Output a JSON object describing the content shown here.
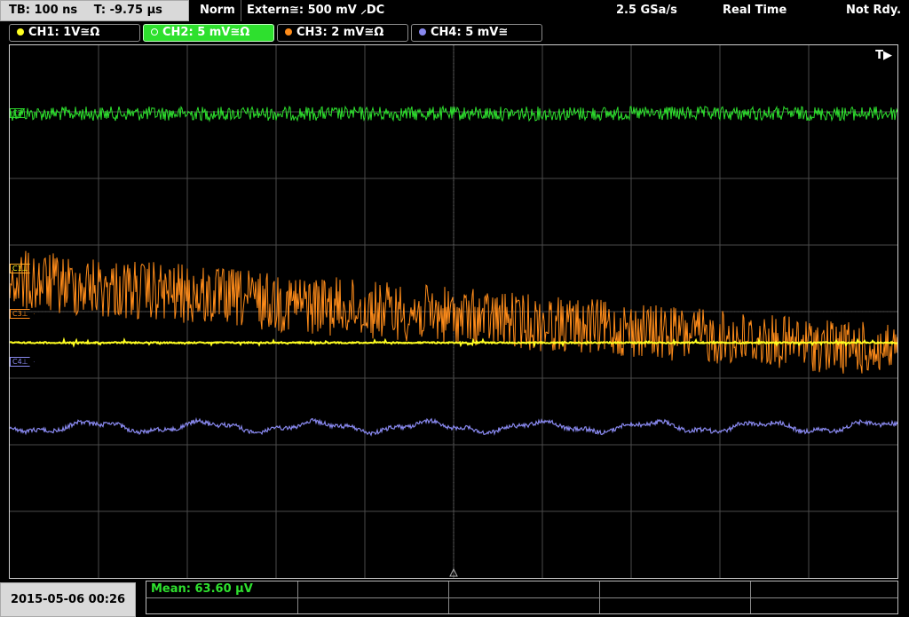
{
  "topbar": {
    "timebase": "TB: 100 ns",
    "trigger_time": "T: -9.75 µs",
    "mode": "Norm",
    "trigger_source": "Extern≅: 500 mV ⸝DC",
    "sample_rate": "2.5 GSa/s",
    "acq_mode": "Real Time",
    "status": "Not Rdy."
  },
  "channels": [
    {
      "label": "CH1: 1V≅Ω",
      "color": "#ffff22"
    },
    {
      "label": "CH2: 5 mV≅Ω",
      "color": "#2ee02e",
      "active": true
    },
    {
      "label": "CH3: 2 mV≅Ω",
      "color": "#ff8c1a"
    },
    {
      "label": "CH4: 5 mV≅",
      "color": "#8888ee"
    }
  ],
  "screen": {
    "trigger_position_marker": "T▶",
    "markers": {
      "c2": "C2",
      "c1": "C1⊥",
      "c3": "C3⊥",
      "c4": "C4⊥"
    }
  },
  "datetime": "2015-05-06 00:26",
  "measurement": {
    "label": "Mean: 63.60 µV"
  },
  "colors": {
    "ch1": "#ffff22",
    "ch2": "#2ee02e",
    "ch3": "#ff8c1a",
    "ch4": "#8888ee",
    "grid": "#4a4a4a"
  }
}
